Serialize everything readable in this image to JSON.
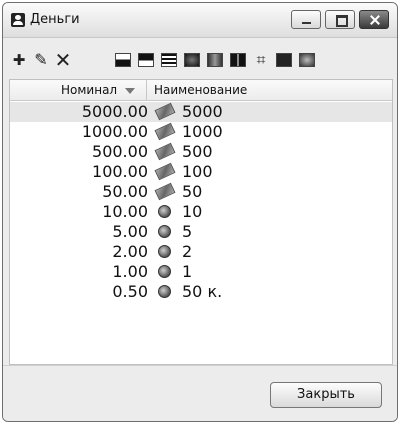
{
  "window": {
    "title": "Деньги",
    "app_icon": "user-icon",
    "controls": [
      "minimize-icon",
      "maximize-icon",
      "close-icon"
    ]
  },
  "toolbar": {
    "actions": [
      "add-icon",
      "edit-icon",
      "delete-icon"
    ],
    "style_swatches": [
      "style-1",
      "style-2",
      "style-3",
      "style-4",
      "style-5",
      "style-6",
      "style-7",
      "style-8",
      "style-9"
    ]
  },
  "table": {
    "columns": {
      "nominal": "Номинал",
      "name": "Наименование"
    },
    "sorted_column": "Номинал",
    "sort_direction": "descending",
    "rows": [
      {
        "nominal": "5000.00",
        "icon": "banknote-icon",
        "name": "5000",
        "selected": true
      },
      {
        "nominal": "1000.00",
        "icon": "banknote-icon",
        "name": "1000"
      },
      {
        "nominal": "500.00",
        "icon": "banknote-icon",
        "name": "500"
      },
      {
        "nominal": "100.00",
        "icon": "banknote-icon",
        "name": "100"
      },
      {
        "nominal": "50.00",
        "icon": "banknote-icon",
        "name": "50"
      },
      {
        "nominal": "10.00",
        "icon": "coin-icon",
        "name": "10"
      },
      {
        "nominal": "5.00",
        "icon": "coin-icon",
        "name": "5"
      },
      {
        "nominal": "2.00",
        "icon": "coin-icon",
        "name": "2"
      },
      {
        "nominal": "1.00",
        "icon": "coin-icon",
        "name": "1"
      },
      {
        "nominal": "0.50",
        "icon": "coin-icon",
        "name": "50 к."
      }
    ]
  },
  "footer": {
    "close_label": "Закрыть"
  }
}
